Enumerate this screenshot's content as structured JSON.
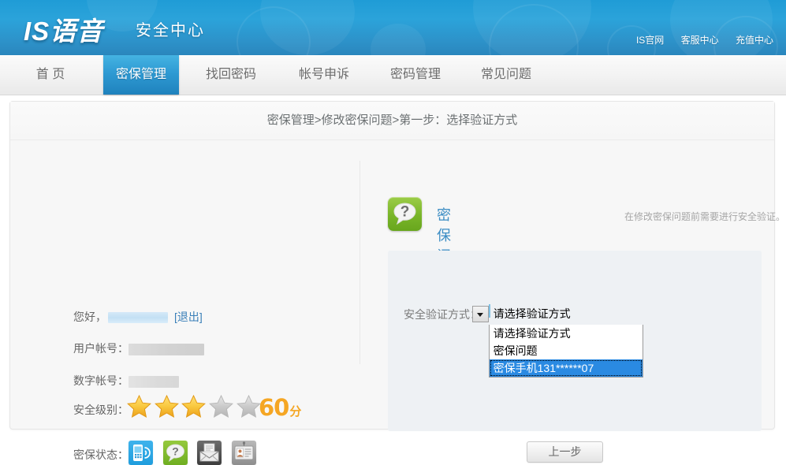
{
  "header": {
    "logo_text": "IS语音",
    "subtitle": "安全中心",
    "top_links": [
      {
        "label": "IS官网"
      },
      {
        "label": "客服中心"
      },
      {
        "label": "充值中心"
      }
    ]
  },
  "nav": {
    "items": [
      {
        "label": "首 页",
        "active": false
      },
      {
        "label": "密保管理",
        "active": true
      },
      {
        "label": "找回密码",
        "active": false
      },
      {
        "label": "帐号申诉",
        "active": false
      },
      {
        "label": "密码管理",
        "active": false
      },
      {
        "label": "常见问题",
        "active": false
      }
    ]
  },
  "breadcrumb": "密保管理>修改密保问题>第一步：选择验证方式",
  "user_panel": {
    "greeting_label": "您好，",
    "greeting_value_redacted": "",
    "logout_label": "[退出]",
    "account_label": "用户帐号：",
    "account_value_redacted": "",
    "number_label": "数字帐号：",
    "number_value_redacted": "",
    "security_level_label": "安全级别：",
    "stars_total": 5,
    "stars_filled": 3,
    "score": "60",
    "score_unit": "分",
    "protect_status_label": "密保状态：",
    "status_icons": [
      {
        "name": "mobile-icon",
        "state": "active"
      },
      {
        "name": "question-icon",
        "state": "active"
      },
      {
        "name": "envelope-icon",
        "state": "inactive"
      },
      {
        "name": "idcard-icon",
        "state": "inactive"
      }
    ]
  },
  "main": {
    "section_title": "密保问题",
    "section_hint": "在修改密保问题前需要进行安全验证。",
    "form": {
      "select_label": "安全验证方式：",
      "select_value": "请选择验证方式",
      "options": [
        {
          "label": "请选择验证方式",
          "selected": false
        },
        {
          "label": "密保问题",
          "selected": false
        },
        {
          "label": "密保手机131******07",
          "selected": true
        }
      ]
    },
    "prev_button": "上一步"
  },
  "colors": {
    "header_blue": "#2ba3da",
    "active_tab_blue": "#2e9ad3",
    "link_blue": "#3a7fb8",
    "title_blue": "#3c8dc4",
    "score_orange": "#f5a623",
    "star_gold": "#f5c63a",
    "star_grey": "#c9c9c9",
    "option_highlight": "#2a8ae2",
    "green_icon": "#79b529"
  }
}
